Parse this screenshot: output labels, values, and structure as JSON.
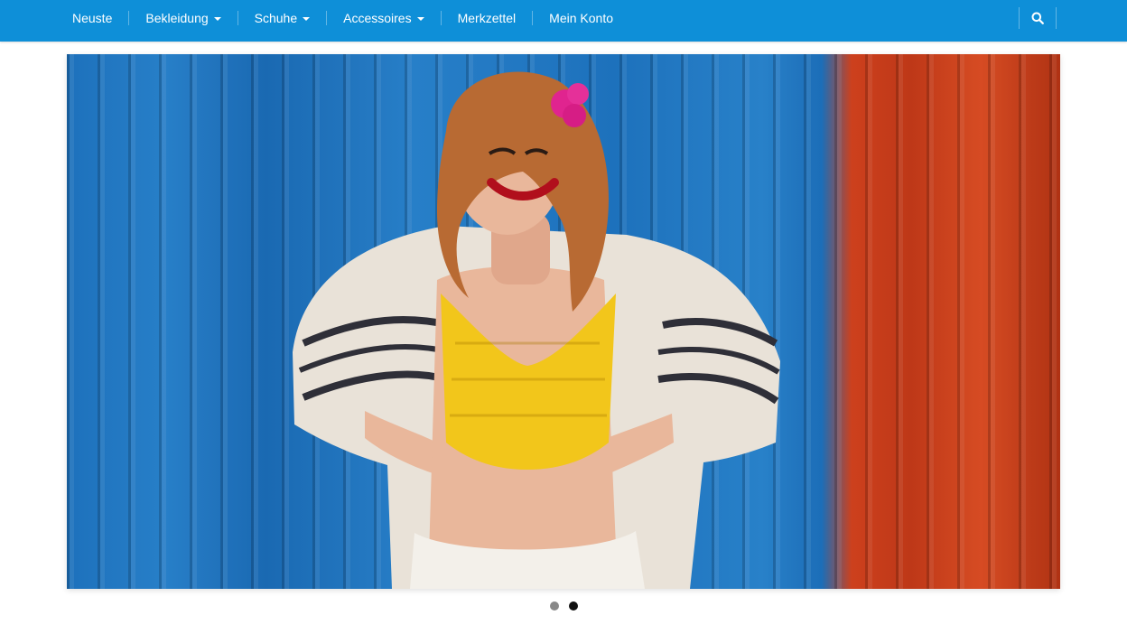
{
  "nav": {
    "items": [
      {
        "label": "Neuste",
        "has_dropdown": false
      },
      {
        "label": "Bekleidung",
        "has_dropdown": true
      },
      {
        "label": "Schuhe",
        "has_dropdown": true
      },
      {
        "label": "Accessoires",
        "has_dropdown": true
      },
      {
        "label": "Merkzettel",
        "has_dropdown": false
      },
      {
        "label": "Mein Konto",
        "has_dropdown": false
      }
    ],
    "search_icon": "search-icon",
    "bar_color": "#0e8fd8"
  },
  "slider": {
    "slide_count": 2,
    "active_slide": 2,
    "image_description_icon": "hero-photo"
  }
}
